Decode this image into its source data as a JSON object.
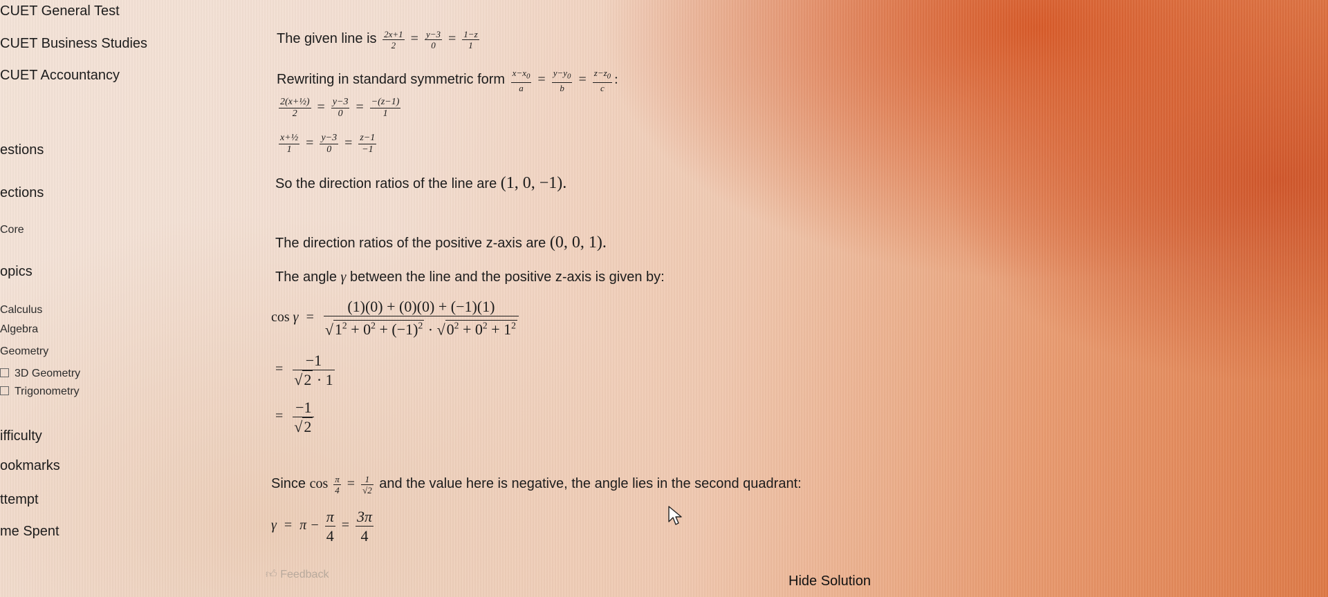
{
  "sidebar": {
    "items": [
      {
        "label": "CUET General Test"
      },
      {
        "label": "CUET Business Studies"
      },
      {
        "label": "CUET Accountancy"
      },
      {
        "label": "estions"
      },
      {
        "label": "ections"
      },
      {
        "label": "Core"
      },
      {
        "label": "opics"
      },
      {
        "label": "Calculus"
      },
      {
        "label": "Algebra"
      },
      {
        "label": "Geometry"
      },
      {
        "label": "3D Geometry"
      },
      {
        "label": "Trigonometry"
      },
      {
        "label": "ifficulty"
      },
      {
        "label": "ookmarks"
      },
      {
        "label": "ttempt"
      },
      {
        "label": "me Spent"
      }
    ]
  },
  "solution": {
    "given_text": "The given line is",
    "rewrite_text": "Rewriting in standard symmetric form",
    "direction_text": "So the direction ratios of the line are",
    "direction_value": "(1, 0, −1).",
    "zaxis_text": "The direction ratios of the positive z-axis are",
    "zaxis_value": "(0, 0, 1).",
    "angle_text_a": "The angle",
    "angle_text_b": "between the line and the positive z-axis is given by:",
    "since_text": "Since",
    "since_text_b": "and the value here is negative, the angle lies in the second quadrant:"
  },
  "footer": {
    "feedback_label": "Feedback",
    "hide_solution_label": "Hide Solution"
  },
  "icons": {
    "feedback": "thumbs-up-icon",
    "cursor": "mouse-pointer-icon"
  }
}
